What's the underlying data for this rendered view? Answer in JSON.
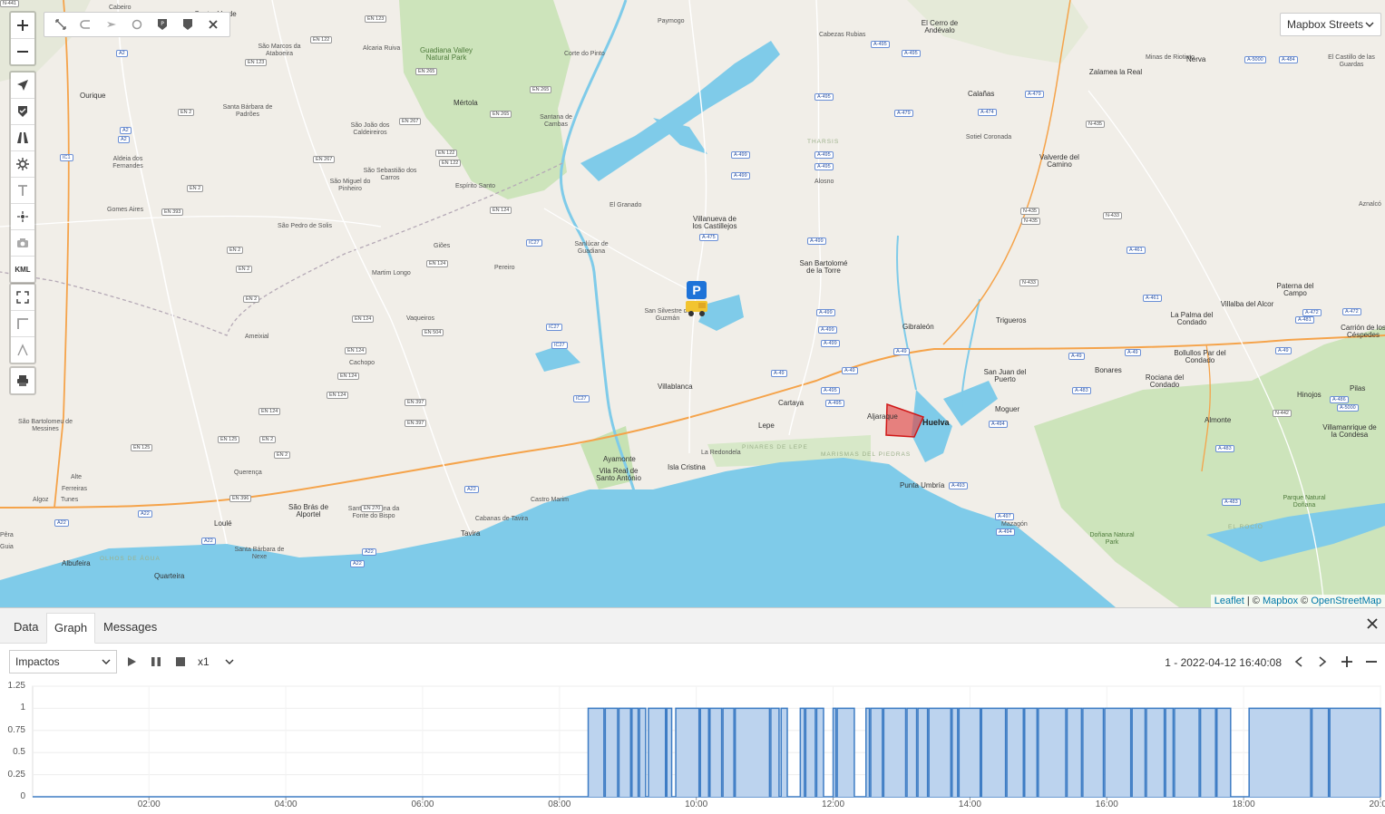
{
  "map": {
    "basemap": {
      "label": "Mapbox Streets"
    },
    "attribution": {
      "leaflet": "Leaflet",
      "sep": "|",
      "copy1": "©",
      "mapbox": "Mapbox",
      "copy2": "©",
      "osm": "OpenStreetMap"
    },
    "controls": {
      "kml": "KML"
    },
    "places": [
      {
        "t": "Castro Verde",
        "c": "big"
      },
      {
        "t": "São Marcos da Ataboeira",
        "c": ""
      },
      {
        "t": "Alcaria Ruiva",
        "c": ""
      },
      {
        "t": "Guadiana Valley Natural Park",
        "c": "park big"
      },
      {
        "t": "Mértola",
        "c": "big"
      },
      {
        "t": "Santana de Cambas",
        "c": ""
      },
      {
        "t": "Ourique",
        "c": "big"
      },
      {
        "t": "Santa Bárbara de Padrões",
        "c": ""
      },
      {
        "t": "São João dos Caldeireiros",
        "c": ""
      },
      {
        "t": "São Miguel do Pinheiro",
        "c": ""
      },
      {
        "t": "São Sebastião dos Carros",
        "c": ""
      },
      {
        "t": "Espírito Santo",
        "c": ""
      },
      {
        "t": "Aldeia dos Fernandes",
        "c": ""
      },
      {
        "t": "Gomes Aires",
        "c": ""
      },
      {
        "t": "São Pedro de Solis",
        "c": ""
      },
      {
        "t": "Martim Longo",
        "c": ""
      },
      {
        "t": "Giões",
        "c": ""
      },
      {
        "t": "Pereiro",
        "c": ""
      },
      {
        "t": "Ameixial",
        "c": ""
      },
      {
        "t": "Vaqueiros",
        "c": ""
      },
      {
        "t": "Cachopo",
        "c": ""
      },
      {
        "t": "São Bartolomeu de Messines",
        "c": ""
      },
      {
        "t": "Querença",
        "c": ""
      },
      {
        "t": "Alte",
        "c": ""
      },
      {
        "t": "Algoz",
        "c": ""
      },
      {
        "t": "Tunes",
        "c": ""
      },
      {
        "t": "Loulé",
        "c": "big"
      },
      {
        "t": "São Brás de Alportel",
        "c": "big"
      },
      {
        "t": "Santa Catarina da Fonte do Bispo",
        "c": ""
      },
      {
        "t": "Santa Bárbara de Nexe",
        "c": ""
      },
      {
        "t": "Albufeira",
        "c": "big"
      },
      {
        "t": "Quarteira",
        "c": "big"
      },
      {
        "t": "Tavira",
        "c": "big"
      },
      {
        "t": "Cabanas de Tavira",
        "c": ""
      },
      {
        "t": "Castro Marim",
        "c": ""
      },
      {
        "t": "Ayamonte",
        "c": "big"
      },
      {
        "t": "Vila Real de Santo António",
        "c": "big"
      },
      {
        "t": "Isla Cristina",
        "c": "big"
      },
      {
        "t": "La Redondela",
        "c": ""
      },
      {
        "t": "Lepe",
        "c": "big"
      },
      {
        "t": "Cartaya",
        "c": "big"
      },
      {
        "t": "PINARES DE LEPE",
        "c": "region"
      },
      {
        "t": "MARISMAS DEL PIEDRAS",
        "c": "region"
      },
      {
        "t": "Villablanca",
        "c": "big"
      },
      {
        "t": "San Silvestre de Guzmán",
        "c": ""
      },
      {
        "t": "Sanlúcar de Guadiana",
        "c": ""
      },
      {
        "t": "El Granado",
        "c": ""
      },
      {
        "t": "Villanueva de los Castillejos",
        "c": "big"
      },
      {
        "t": "Paymogo",
        "c": ""
      },
      {
        "t": "Cabezas Rubias",
        "c": ""
      },
      {
        "t": "El Cerro de Andévalo",
        "c": "big"
      },
      {
        "t": "Alosno",
        "c": ""
      },
      {
        "t": "THARSIS",
        "c": "region"
      },
      {
        "t": "San Bartolomé de la Torre",
        "c": "big"
      },
      {
        "t": "Gibraleón",
        "c": "big"
      },
      {
        "t": "Aljaraque",
        "c": "big"
      },
      {
        "t": "Huelva",
        "c": "city"
      },
      {
        "t": "Punta Umbría",
        "c": "big"
      },
      {
        "t": "Trigueros",
        "c": "big"
      },
      {
        "t": "San Juan del Puerto",
        "c": "big"
      },
      {
        "t": "Moguer",
        "c": "big"
      },
      {
        "t": "Mazagón",
        "c": ""
      },
      {
        "t": "Calañas",
        "c": "big"
      },
      {
        "t": "Sotiel Coronada",
        "c": ""
      },
      {
        "t": "Valverde del Camino",
        "c": "big"
      },
      {
        "t": "Zalamea la Real",
        "c": "big"
      },
      {
        "t": "Minas de Riotinto",
        "c": ""
      },
      {
        "t": "Nerva",
        "c": "big"
      },
      {
        "t": "El Castillo de las Guardas",
        "c": ""
      },
      {
        "t": "Aznalcó",
        "c": ""
      },
      {
        "t": "Paterna del Campo",
        "c": "big"
      },
      {
        "t": "La Palma del Condado",
        "c": "big"
      },
      {
        "t": "Villalba del Alcor",
        "c": "big"
      },
      {
        "t": "Carrión de los Céspedes",
        "c": "big"
      },
      {
        "t": "Bollullos Par del Condado",
        "c": "big"
      },
      {
        "t": "Bonares",
        "c": "big"
      },
      {
        "t": "Rociana del Condado",
        "c": "big"
      },
      {
        "t": "Almonte",
        "c": "big"
      },
      {
        "t": "Hinojos",
        "c": "big"
      },
      {
        "t": "Pilas",
        "c": "big"
      },
      {
        "t": "Villamanrique de la Condesa",
        "c": "big"
      },
      {
        "t": "Doñana Natural Park",
        "c": "park"
      },
      {
        "t": "Parque Natural Doñana",
        "c": "park"
      },
      {
        "t": "EL ROCÍO",
        "c": "region"
      },
      {
        "t": "Pêra",
        "c": ""
      },
      {
        "t": "Guia",
        "c": ""
      },
      {
        "t": "Ferreiras",
        "c": ""
      },
      {
        "t": "OLHOS DE ÁGUA",
        "c": "region"
      },
      {
        "t": "Cabeiro",
        "c": ""
      },
      {
        "t": "Corte do Pinto",
        "c": ""
      }
    ],
    "shields": [
      "EN 123",
      "EN 122",
      "EN 123",
      "EN 265",
      "IC1",
      "EN 2",
      "A2",
      "A2",
      "A2",
      "EN 267",
      "EN 267",
      "EN 122",
      "EN 122",
      "EN 265",
      "EN 265",
      "EN 2",
      "EN 2",
      "EN 393",
      "EN 124",
      "EN 124",
      "EN 2",
      "EN 2",
      "EN 124",
      "EN 124",
      "EN 124",
      "EN 504",
      "EN 124",
      "EN 124",
      "IC27",
      "IC27",
      "IC27",
      "IC27",
      "EN 397",
      "EN 397",
      "EN 2",
      "EN 2",
      "EN 396",
      "EN 270",
      "EN 125",
      "EN 125",
      "A22",
      "A22",
      "A22",
      "A22",
      "A22",
      "A22",
      "A-499",
      "A-499",
      "A-495",
      "A-495",
      "A-495",
      "A-495",
      "A-499",
      "A-499",
      "A-499",
      "A-499",
      "A-475",
      "A-495",
      "A-495",
      "A-495",
      "A-479",
      "A-479",
      "A-49",
      "A-49",
      "A-49",
      "A-49",
      "A-49",
      "A-49",
      "A-494",
      "A-494",
      "A-497",
      "A-5000",
      "A-483",
      "A-483",
      "A-483",
      "A-481",
      "A-472",
      "A-472",
      "A-474",
      "N-435",
      "N-435",
      "N-435",
      "N-433",
      "N-433",
      "A-461",
      "A-461",
      "A-493",
      "N-442",
      "A-484",
      "A-486",
      "A-5000",
      "N-441"
    ]
  },
  "panel": {
    "tabs": [
      {
        "label": "Data"
      },
      {
        "label": "Graph"
      },
      {
        "label": "Messages"
      }
    ],
    "variable_select": {
      "value": "Impactos"
    },
    "speed_select": {
      "value": "x1"
    },
    "timestamp": "1 - 2022-04-12 16:40:08"
  },
  "chart_data": {
    "type": "area",
    "title": "",
    "xlabel": "",
    "ylabel": "",
    "step": true,
    "x_unit": "hour of day",
    "xlim": [
      0.3,
      20.0
    ],
    "ylim": [
      0,
      1.25
    ],
    "yticks": [
      "0",
      "0.25",
      "0.5",
      "0.75",
      "1",
      "1.25"
    ],
    "xticks": [
      "02:00",
      "04:00",
      "06:00",
      "08:00",
      "10:00",
      "12:00",
      "14:00",
      "16:00",
      "18:00",
      "20:00"
    ],
    "grid": true,
    "series": [
      {
        "color": "#3d7cc4",
        "fill": "#bcd3ee",
        "on_intervals": [
          [
            8.42,
            8.65
          ],
          [
            8.67,
            8.85
          ],
          [
            8.87,
            9.04
          ],
          [
            9.06,
            9.15
          ],
          [
            9.17,
            9.26
          ],
          [
            9.3,
            9.55
          ],
          [
            9.57,
            9.64
          ],
          [
            9.7,
            10.04
          ],
          [
            10.06,
            10.18
          ],
          [
            10.2,
            10.37
          ],
          [
            10.39,
            10.55
          ],
          [
            10.57,
            11.07
          ],
          [
            11.09,
            11.21
          ],
          [
            11.24,
            11.33
          ],
          [
            11.52,
            11.58
          ],
          [
            11.6,
            11.74
          ],
          [
            11.76,
            11.86
          ],
          [
            12.0,
            12.04
          ],
          [
            12.06,
            12.31
          ],
          [
            12.48,
            12.53
          ],
          [
            12.55,
            12.72
          ],
          [
            12.74,
            13.06
          ],
          [
            13.08,
            13.22
          ],
          [
            13.24,
            13.38
          ],
          [
            13.4,
            13.72
          ],
          [
            13.74,
            13.82
          ],
          [
            13.84,
            14.15
          ],
          [
            14.17,
            14.52
          ],
          [
            14.54,
            14.78
          ],
          [
            14.8,
            14.98
          ],
          [
            15.0,
            15.4
          ],
          [
            15.42,
            15.63
          ],
          [
            15.65,
            15.95
          ],
          [
            15.97,
            16.35
          ],
          [
            16.37,
            16.56
          ],
          [
            16.58,
            16.84
          ],
          [
            16.86,
            16.97
          ],
          [
            16.99,
            17.35
          ],
          [
            17.37,
            17.59
          ],
          [
            17.61,
            17.81
          ],
          [
            18.08,
            18.98
          ],
          [
            19.0,
            19.24
          ],
          [
            19.26,
            20.0
          ]
        ]
      }
    ]
  }
}
